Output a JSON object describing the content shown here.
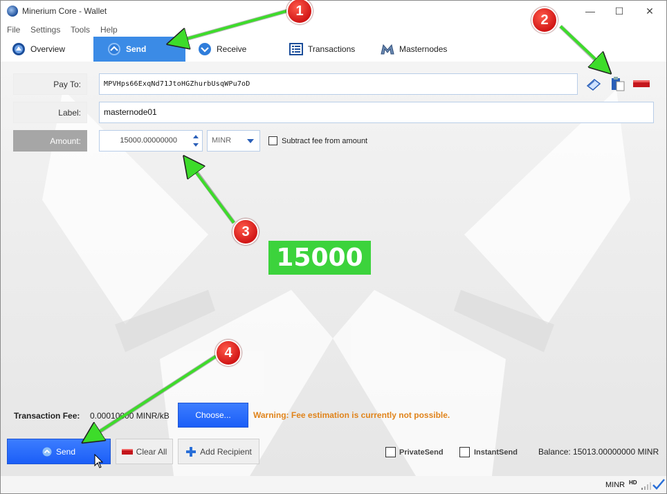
{
  "window": {
    "title": "Minerium Core - Wallet",
    "controls": {
      "minimize": "—",
      "maximize": "☐",
      "close": "✕"
    }
  },
  "menu": [
    "File",
    "Settings",
    "Tools",
    "Help"
  ],
  "tabs": [
    {
      "label": "Overview",
      "icon": "overview-icon",
      "active": false
    },
    {
      "label": "Send",
      "icon": "send-icon",
      "active": true
    },
    {
      "label": "Receive",
      "icon": "receive-icon",
      "active": false
    },
    {
      "label": "Transactions",
      "icon": "transactions-icon",
      "active": false
    },
    {
      "label": "Masternodes",
      "icon": "masternodes-icon",
      "active": false
    }
  ],
  "form": {
    "pay_to_label": "Pay To:",
    "pay_to_value": "MPVHps66ExqNd71JtoHGZhurbUsqWPu7oD",
    "label_label": "Label:",
    "label_value": "masternode01",
    "amount_label": "Amount:",
    "amount_value": "15000.00000000",
    "unit": "MINR",
    "subtract_fee_label": "Subtract fee from amount"
  },
  "annotations": {
    "badge_1": "1",
    "badge_2": "2",
    "badge_3": "3",
    "badge_4": "4",
    "amount_callout": "15000",
    "arrow_color": "#3ddc2a",
    "badge_color": "#d9231c"
  },
  "fee": {
    "label": "Transaction Fee:",
    "value": "0.00010000 MINR/kB",
    "choose_button": "Choose...",
    "warning": "Warning: Fee estimation is currently not possible."
  },
  "actions": {
    "send_button": "Send",
    "clear_all_button": "Clear All",
    "add_recipient_button": "Add Recipient",
    "private_send_label": "PrivateSend",
    "instant_send_label": "InstantSend",
    "balance": "Balance: 15013.00000000 MINR"
  },
  "status": {
    "unit": "MINR",
    "hd": "HD"
  },
  "colors": {
    "accent": "#3b8be6",
    "button_blue": "#1b5ef7",
    "warning": "#e0831a"
  }
}
